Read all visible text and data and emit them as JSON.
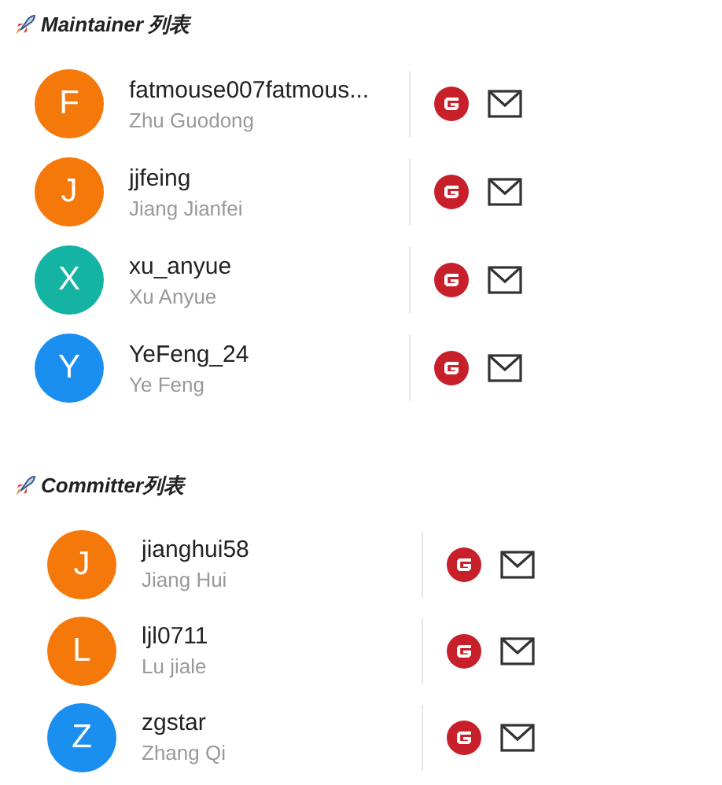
{
  "sections": [
    {
      "title": "Maintainer 列表",
      "members": [
        {
          "initial": "F",
          "color": "#f5780a",
          "username": "fatmouse007fatmous...",
          "name": "Zhu Guodong"
        },
        {
          "initial": "J",
          "color": "#f5780a",
          "username": "jjfeing",
          "name": "Jiang Jianfei"
        },
        {
          "initial": "X",
          "color": "#14b3a3",
          "username": "xu_anyue",
          "name": "Xu Anyue"
        },
        {
          "initial": "Y",
          "color": "#1b8ff0",
          "username": "YeFeng_24",
          "name": "Ye Feng"
        }
      ]
    },
    {
      "title": "Committer列表",
      "members": [
        {
          "initial": "J",
          "color": "#f5780a",
          "username": "jianghui58",
          "name": "Jiang Hui"
        },
        {
          "initial": "L",
          "color": "#f5780a",
          "username": "ljl0711",
          "name": "Lu jiale"
        },
        {
          "initial": "Z",
          "color": "#1b8ff0",
          "username": "zgstar",
          "name": "Zhang Qi"
        }
      ]
    }
  ]
}
